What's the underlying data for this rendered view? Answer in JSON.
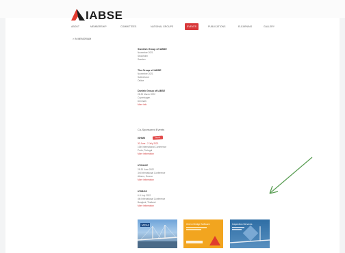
{
  "header": {
    "logo_text": "IABSE",
    "nav": [
      "ABOUT",
      "MEMBERSHIP",
      "COMMITTEES",
      "NATIONAL GROUPS",
      "EVENTS",
      "PUBLICATIONS",
      "ELEARNING",
      "GALLERY"
    ],
    "active_nav_index": 4,
    "subnav_label": "> IN MEMORIAM"
  },
  "events": {
    "group_entries": [
      {
        "title": "Swedish Group of IABSE",
        "lines": [
          "November 2021",
          "Stockholm",
          "Sweden"
        ]
      },
      {
        "title": "The Group of IABSE",
        "lines": [
          "November 2021",
          "Switzerland",
          "Online"
        ]
      },
      {
        "title": "Danish Group of IABSE",
        "lines": [
          "28-30 March 2022",
          "Copenhagen",
          "Denmark"
        ],
        "link": "More info"
      }
    ],
    "co_sponsored_heading": "Co-Sponsored Events",
    "co_entries": [
      {
        "title": "ISHMII",
        "badge": "NEW DATE",
        "lines": [
          "30 June - 2 July 2021",
          "10th International Conference",
          "Porto, Portugal"
        ],
        "link": "More information"
      },
      {
        "title": "ICONHIC",
        "lines": [
          "28-30 June 2022",
          "3rd International Conference",
          "Athens, Greece"
        ],
        "link": "More information"
      },
      {
        "title": "ICSBOS",
        "lines": [
          "6-8 July 2022",
          "4th International Conference",
          "Bangkok, Thailand"
        ],
        "link": "More information"
      }
    ]
  },
  "banners": [
    {
      "name": "banner-one",
      "title": "MIDAS"
    },
    {
      "name": "banner-two",
      "title": "Civil & Bridge Software"
    },
    {
      "name": "banner-three",
      "title": "Inspection Services"
    }
  ],
  "colors": {
    "accent": "#d8383a",
    "annotation_arrow": "#5a9e54"
  }
}
